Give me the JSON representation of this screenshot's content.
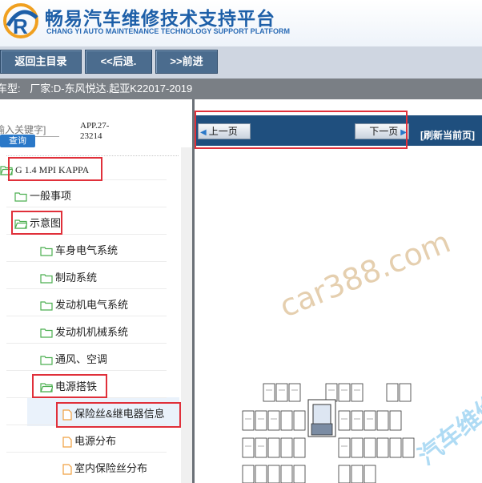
{
  "header": {
    "title": "畅易汽车维修技术支持平台",
    "subtitle": "CHANG YI AUTO MAINTENANCE TECHNOLOGY SUPPORT PLATFORM",
    "logo_icon": "cr-logo-icon",
    "brand_color": "#1d5fa8"
  },
  "nav": {
    "home": "返回主目录",
    "back": "<<后退.",
    "forward": ">>前进"
  },
  "vehicle": {
    "label": "车型:",
    "value": "厂家:D-东风悦达.起亚K22017-2019"
  },
  "search": {
    "placeholder": "输入关键字]",
    "button": "查询",
    "code_line1": "APP.27-",
    "code_line2": "23214"
  },
  "tree": {
    "engine": "G 1.4 MPI KAPPA",
    "general": "一般事项",
    "schematic": "示意图",
    "body_electrical": "车身电气系统",
    "brakes": "制动系统",
    "engine_electrical": "发动机电气系统",
    "engine_mechanical": "发动机机械系统",
    "hvac": "通风、空调",
    "power_ground": "电源搭铁",
    "fuse_relay": "保险丝&继电器信息",
    "power_distribution": "电源分布",
    "interior_fuse": "室内保险丝分布"
  },
  "viewer": {
    "prev": "上一页",
    "next": "下一页",
    "refresh": "[刷新当前页]"
  },
  "watermark": {
    "text": "car388.com",
    "text2": "汽车维修平"
  },
  "colors": {
    "highlight_box": "#e0303a",
    "folder": "#4caf50",
    "toolbar": "#1f4f7e",
    "nav_button": "#4b6c8e"
  }
}
